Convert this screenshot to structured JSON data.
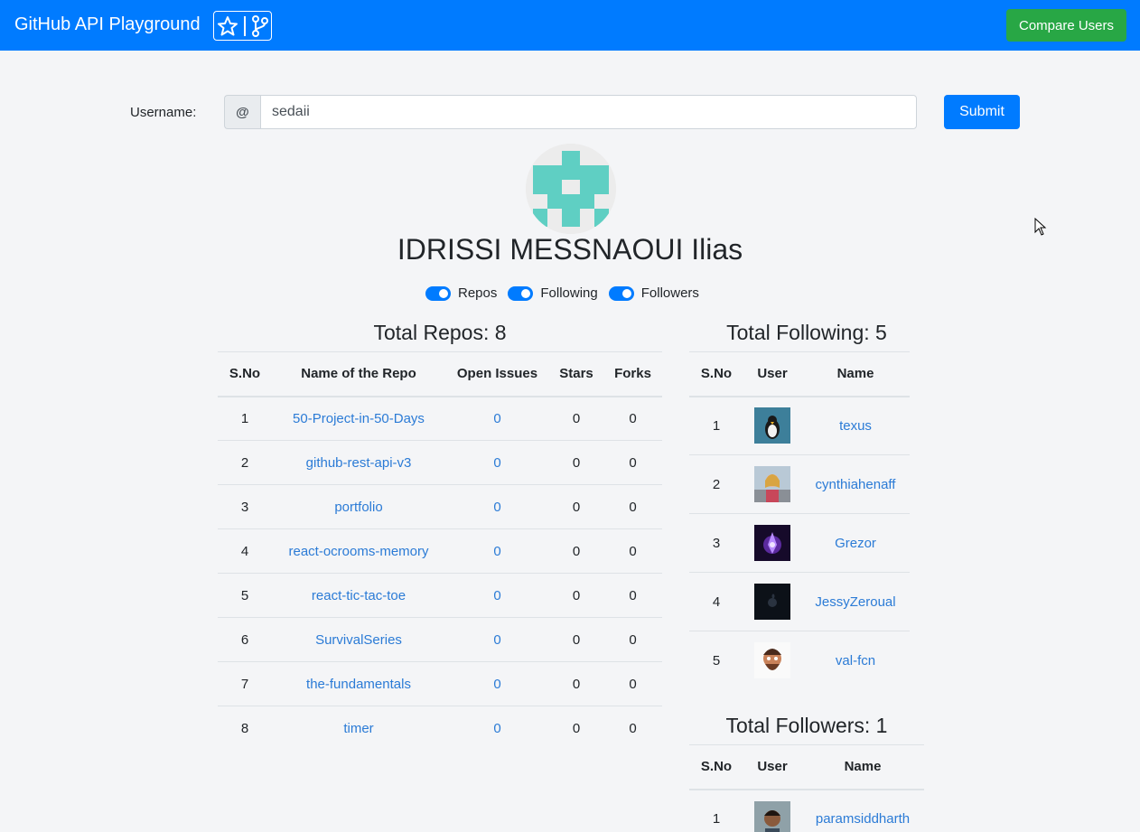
{
  "navbar": {
    "brand": "GitHub API Playground",
    "compare_label": "Compare Users"
  },
  "form": {
    "username_label": "Username:",
    "prefix": "@",
    "username_value": "sedaii",
    "submit_label": "Submit"
  },
  "profile": {
    "name": "IDRISSI MESSNAOUI Ilias"
  },
  "toggles": {
    "repos": "Repos",
    "following": "Following",
    "followers": "Followers"
  },
  "repos": {
    "title": "Total Repos: 8",
    "columns": [
      "S.No",
      "Name of the Repo",
      "Open Issues",
      "Stars",
      "Forks"
    ],
    "rows": [
      {
        "sno": "1",
        "name": "50-Project-in-50-Days",
        "issues": "0",
        "stars": "0",
        "forks": "0"
      },
      {
        "sno": "2",
        "name": "github-rest-api-v3",
        "issues": "0",
        "stars": "0",
        "forks": "0"
      },
      {
        "sno": "3",
        "name": "portfolio",
        "issues": "0",
        "stars": "0",
        "forks": "0"
      },
      {
        "sno": "4",
        "name": "react-ocrooms-memory",
        "issues": "0",
        "stars": "0",
        "forks": "0"
      },
      {
        "sno": "5",
        "name": "react-tic-tac-toe",
        "issues": "0",
        "stars": "0",
        "forks": "0"
      },
      {
        "sno": "6",
        "name": "SurvivalSeries",
        "issues": "0",
        "stars": "0",
        "forks": "0"
      },
      {
        "sno": "7",
        "name": "the-fundamentals",
        "issues": "0",
        "stars": "0",
        "forks": "0"
      },
      {
        "sno": "8",
        "name": "timer",
        "issues": "0",
        "stars": "0",
        "forks": "0"
      }
    ]
  },
  "following": {
    "title": "Total Following: 5",
    "columns": [
      "S.No",
      "User",
      "Name"
    ],
    "rows": [
      {
        "sno": "1",
        "name": "texus"
      },
      {
        "sno": "2",
        "name": "cynthiahenaff"
      },
      {
        "sno": "3",
        "name": "Grezor"
      },
      {
        "sno": "4",
        "name": "JessyZeroual"
      },
      {
        "sno": "5",
        "name": "val-fcn"
      }
    ]
  },
  "followers": {
    "title": "Total Followers: 1",
    "columns": [
      "S.No",
      "User",
      "Name"
    ],
    "rows": [
      {
        "sno": "1",
        "name": "paramsiddharth"
      }
    ]
  },
  "colors": {
    "primary": "#007bff",
    "success": "#28a745",
    "link": "#2b7bd6",
    "identicon": "#5fcfc3"
  },
  "icons": [
    "star-icon",
    "git-branch-icon",
    "mouse-cursor-icon"
  ]
}
